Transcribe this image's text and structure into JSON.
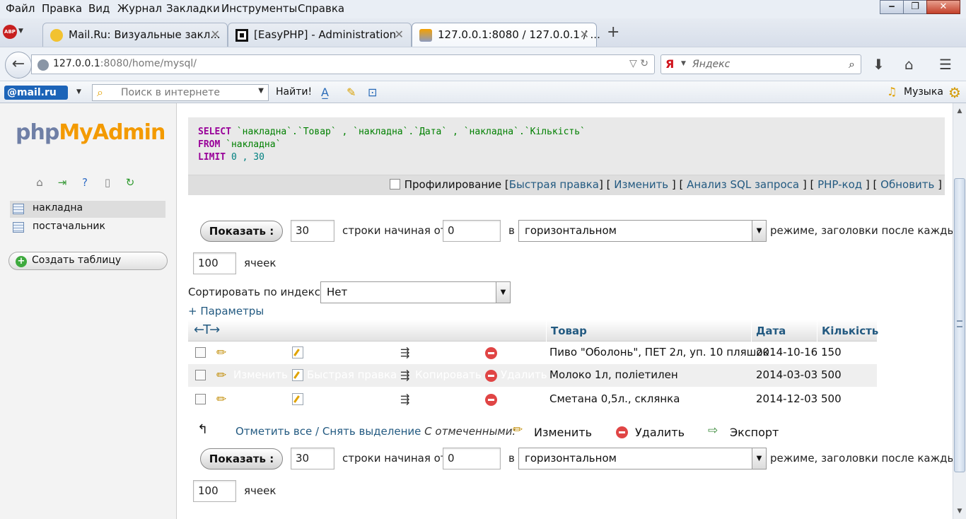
{
  "menubar": {
    "items": [
      "Файл",
      "Правка",
      "Вид",
      "Журнал",
      "Закладки",
      "Инструменты",
      "Справка"
    ],
    "window_min": "‒",
    "window_max": "❐",
    "window_close": "✕"
  },
  "tabs": [
    {
      "title": "Mail.Ru: Визуальные закл...",
      "icon": "mailru-favicon"
    },
    {
      "title": "[EasyPHP] - Administration",
      "icon": "easyphp-favicon"
    },
    {
      "title": "127.0.0.1:8080 / 127.0.0.1 / ...",
      "icon": "pma-favicon"
    }
  ],
  "tab_close": "✕",
  "new_tab": "+",
  "abp_label": "ABP",
  "navbar": {
    "url_host": "127.0.0.1",
    "url_rest": ":8080/home/mysql/",
    "search_placeholder": "Яндекс",
    "search_engine": "Я"
  },
  "mailbar": {
    "logo": "@mail.ru",
    "search_placeholder": "Поиск в интернете",
    "search_button": "Найти!",
    "music_label": "Музыка"
  },
  "left": {
    "logo_php": "php",
    "logo_myadmin": "MyAdmin",
    "tables": [
      "накладна",
      "постачальник"
    ],
    "create_table": "Создать таблицу"
  },
  "sql": {
    "select_kw": "SELECT",
    "select_cols": " `накладна`.`Товар` , `накладна`.`Дата` , `накладна`.`Кількість`",
    "from_kw": "FROM",
    "from_tbl": " `накладна`",
    "limit_kw": "LIMIT",
    "limit_vals": " 0 , 30",
    "profiling": "Профилирование",
    "links": [
      "Быстрая правка",
      "Изменить",
      "Анализ SQL запроса",
      "PHP-код",
      "Обновить"
    ]
  },
  "nav_top": {
    "show_button": "Показать :",
    "rows": "30",
    "rows_label": "строки начиная от",
    "start": "0",
    "in_label": "в",
    "mode": "горизонтальном",
    "mode_tail": "режиме, заголовки после каждых",
    "cells": "100",
    "cells_label": "ячеек"
  },
  "sort": {
    "label": "Сортировать по индексу:",
    "value": "Нет"
  },
  "params_link": "+ Параметры",
  "columns": [
    "Товар",
    "Дата",
    "Кількість"
  ],
  "row_actions": [
    "Изменить",
    "Быстрая правка",
    "Копировать",
    "Удалить"
  ],
  "rows": [
    {
      "tovar": "Пиво \"Оболонь\", ПЕТ 2л, уп. 10 пляшок",
      "data": "2014-10-16",
      "kilkist": "150"
    },
    {
      "tovar": "Молоко 1л, поліетилен",
      "data": "2014-03-03",
      "kilkist": "500"
    },
    {
      "tovar": "Сметана 0,5л., склянка",
      "data": "2014-12-03",
      "kilkist": "500"
    }
  ],
  "bulk": {
    "check_all": "Отметить все",
    "separator": " / ",
    "uncheck_all": "Снять выделение",
    "with_selected": "С отмеченными:",
    "edit": "Изменить",
    "delete": "Удалить",
    "export": "Экспорт"
  }
}
